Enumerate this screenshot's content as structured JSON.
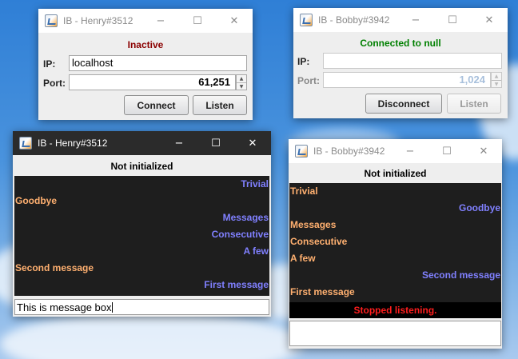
{
  "colors": {
    "inactive": "#8b0000",
    "connected": "#008000",
    "remote_message": "#8080ff",
    "local_message": "#ffb070",
    "stopped": "#ff1d1d",
    "chat_background": "#1e1e1e"
  },
  "icons": {
    "minimize": "−",
    "maximize": "☐",
    "close": "✕",
    "spin_up": "▲",
    "spin_down": "▼"
  },
  "henry_connection": {
    "title": "IB - Henry#3512",
    "status": "Inactive",
    "ip_label": "IP:",
    "ip_value": "localhost",
    "port_label": "Port:",
    "port_value": "61,251",
    "connect_label": "Connect",
    "listen_label": "Listen"
  },
  "bobby_connection": {
    "title": "IB - Bobby#3942",
    "status": "Connected to null",
    "ip_label": "IP:",
    "ip_value": "",
    "port_label": "Port:",
    "port_value": "1,024",
    "disconnect_label": "Disconnect",
    "listen_label": "Listen"
  },
  "henry_chat": {
    "title": "IB - Henry#3512",
    "status": "Not initialized",
    "messages": [
      {
        "text": "Trivial",
        "side": "right"
      },
      {
        "text": "Goodbye",
        "side": "left"
      },
      {
        "text": "Messages",
        "side": "right"
      },
      {
        "text": "Consecutive",
        "side": "right"
      },
      {
        "text": "A few",
        "side": "right"
      },
      {
        "text": "Second message",
        "side": "left"
      },
      {
        "text": "First message",
        "side": "right"
      }
    ],
    "message_box_value": "This is message box"
  },
  "bobby_chat": {
    "title": "IB - Bobby#3942",
    "status": "Not initialized",
    "messages": [
      {
        "text": "Trivial",
        "side": "left"
      },
      {
        "text": "Goodbye",
        "side": "right"
      },
      {
        "text": "Messages",
        "side": "left"
      },
      {
        "text": "Consecutive",
        "side": "left"
      },
      {
        "text": "A few",
        "side": "left"
      },
      {
        "text": "Second message",
        "side": "right"
      },
      {
        "text": "First message",
        "side": "left"
      }
    ],
    "stopped_text": "Stopped listening.",
    "message_box_value": ""
  }
}
